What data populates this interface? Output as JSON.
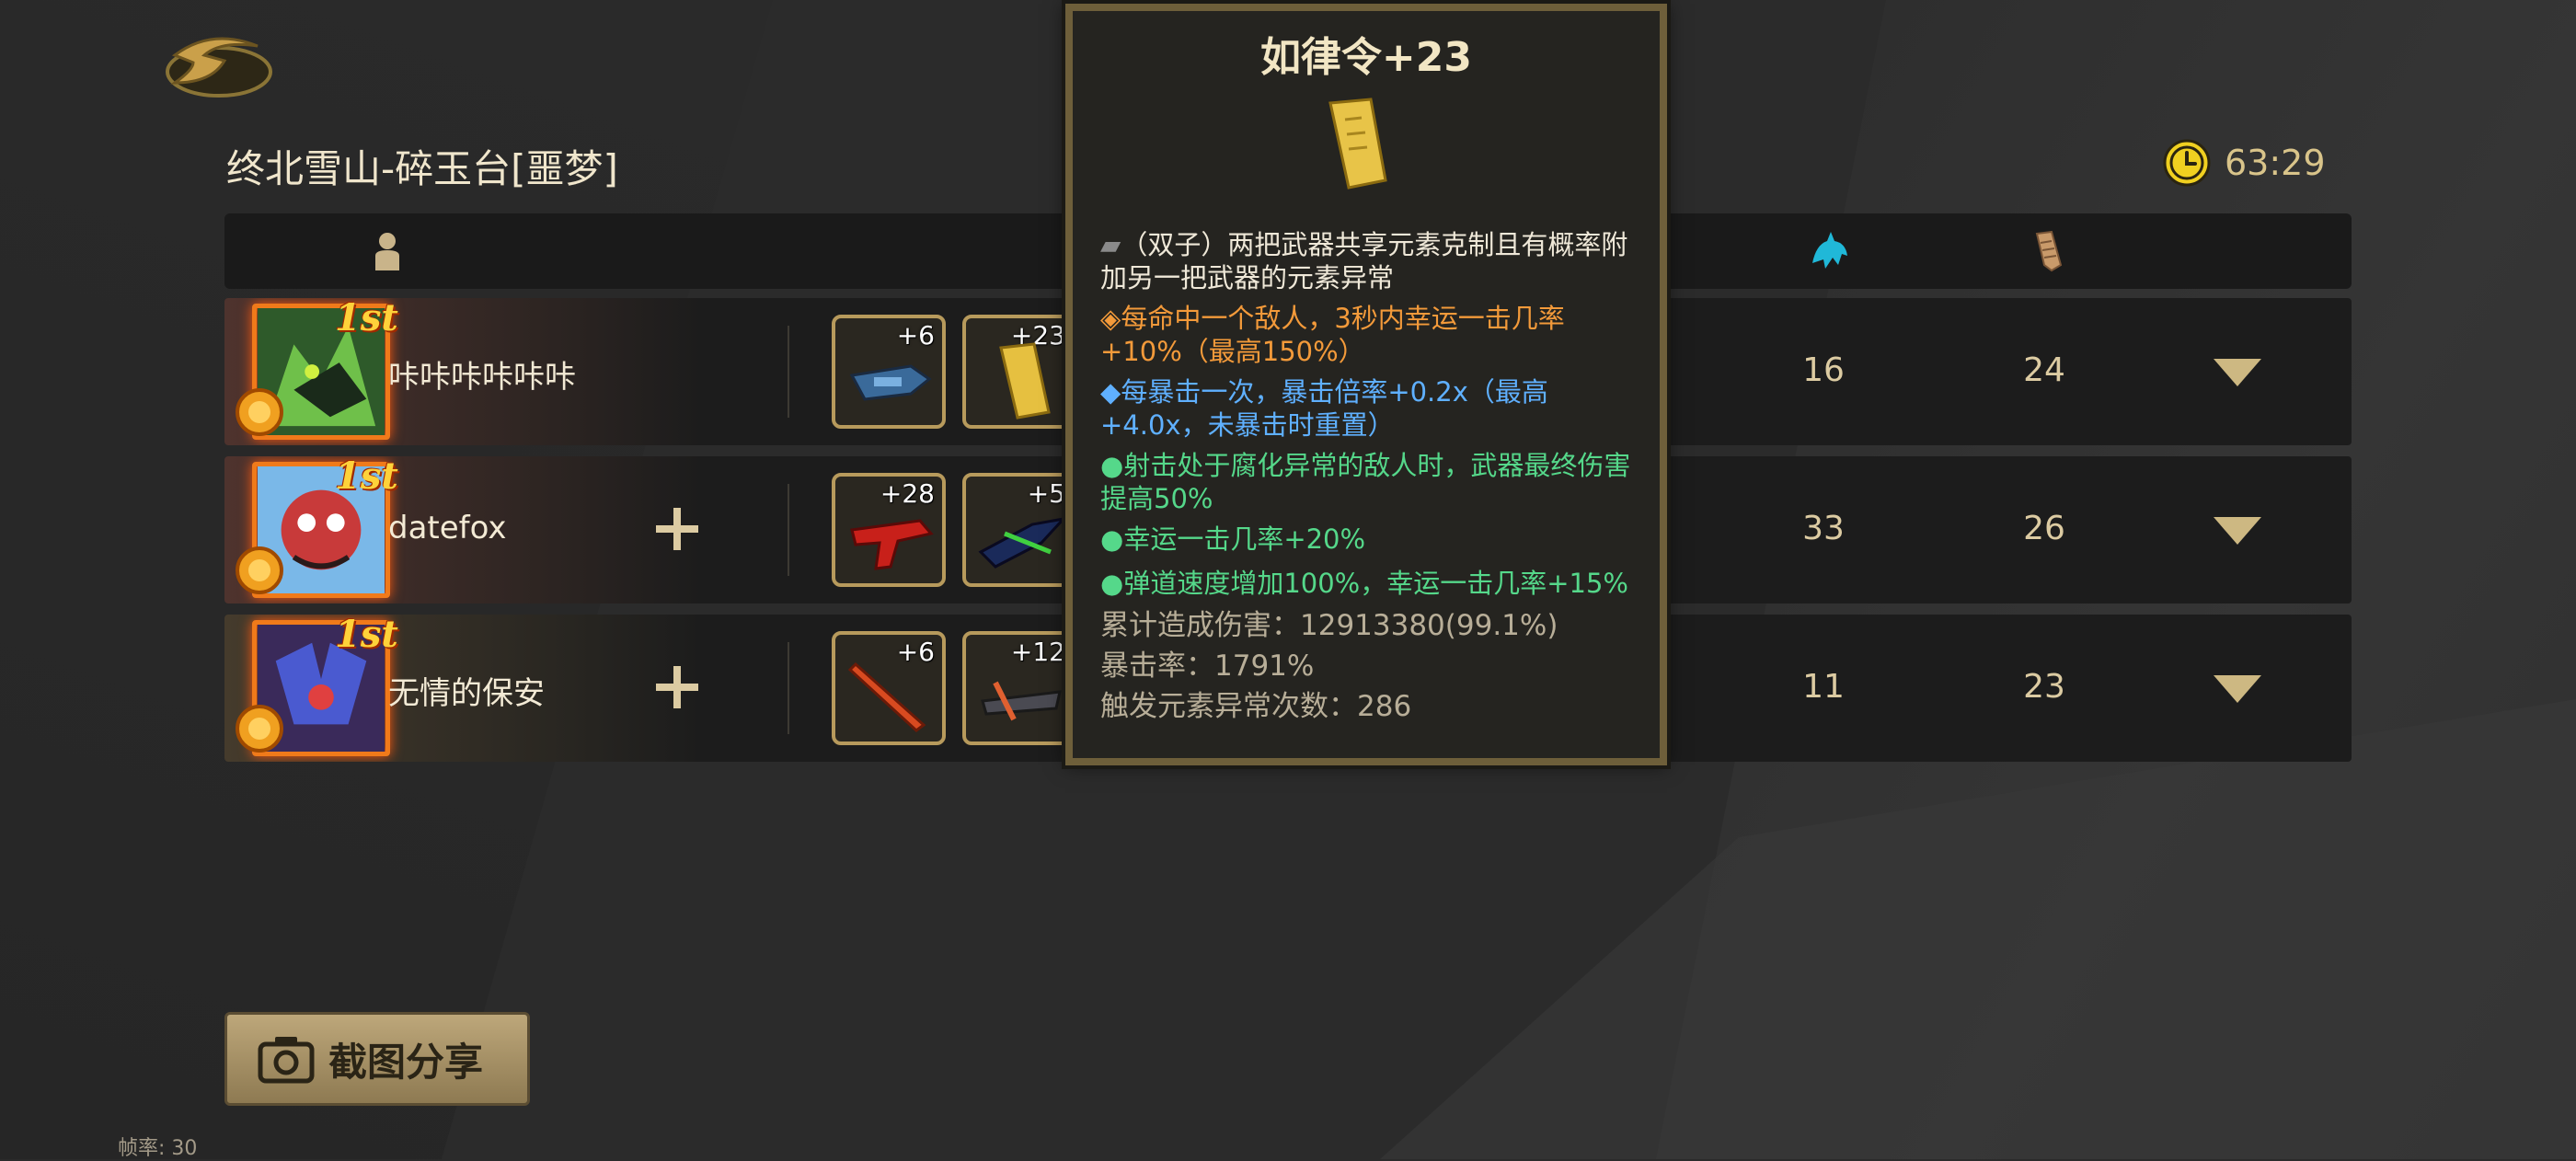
{
  "map_title": "终北雪山-碎玉台[噩梦]",
  "timer": "63:29",
  "header_icons": [
    "player-icon",
    "kill-icon",
    "scroll-icon"
  ],
  "players": [
    {
      "name": "咔咔咔咔咔咔",
      "rank": "1st",
      "weapons": [
        {
          "level": "+6",
          "icon": "blue-gun-icon"
        },
        {
          "level": "+23",
          "icon": "talisman-icon"
        }
      ],
      "stat_a": "16",
      "stat_b": "24",
      "add_friend": false
    },
    {
      "name": "datefox",
      "rank": "1st",
      "weapons": [
        {
          "level": "+28",
          "icon": "red-pistol-icon"
        },
        {
          "level": "+5",
          "icon": "green-rifle-icon"
        }
      ],
      "stat_a": "33",
      "stat_b": "26",
      "add_friend": true
    },
    {
      "name": "无情的保安",
      "rank": "1st",
      "weapons": [
        {
          "level": "+6",
          "icon": "red-sword-icon"
        },
        {
          "level": "+12",
          "icon": "crossbow-icon"
        }
      ],
      "stat_a": "11",
      "stat_b": "23",
      "add_friend": true
    }
  ],
  "tooltip": {
    "title": "如律令+23",
    "lines": [
      {
        "text": "（双子）两把武器共享元素克制且有概率附加另一把武器的元素异常",
        "color": "white",
        "bullet": "▰"
      },
      {
        "text": "每命中一个敌人，3秒内幸运一击几率+10%（最高150%）",
        "color": "orange",
        "bullet": "◈"
      },
      {
        "text": "每暴击一次，暴击倍率+0.2x（最高+4.0x，未暴击时重置）",
        "color": "blue",
        "bullet": "◆"
      },
      {
        "text": "射击处于腐化异常的敌人时，武器最终伤害提高50%",
        "color": "green",
        "bullet": "●"
      },
      {
        "text": "幸运一击几率+20%",
        "color": "green",
        "bullet": "●"
      },
      {
        "text": "弹道速度增加100%，幸运一击几率+15%",
        "color": "green",
        "bullet": "●"
      }
    ],
    "stats": [
      "累计造成伤害：12913380(99.1%)",
      "暴击率：1791%",
      "触发元素异常次数：286"
    ]
  },
  "share_button": "截图分享",
  "fps_label": "帧率: 30",
  "colors": {
    "accent_gold": "#b79a5c",
    "rank_orange": "#f07a1a",
    "tooltip_orange": "#f39a3a",
    "tooltip_blue": "#5fb0ff",
    "tooltip_green": "#55d88a"
  }
}
